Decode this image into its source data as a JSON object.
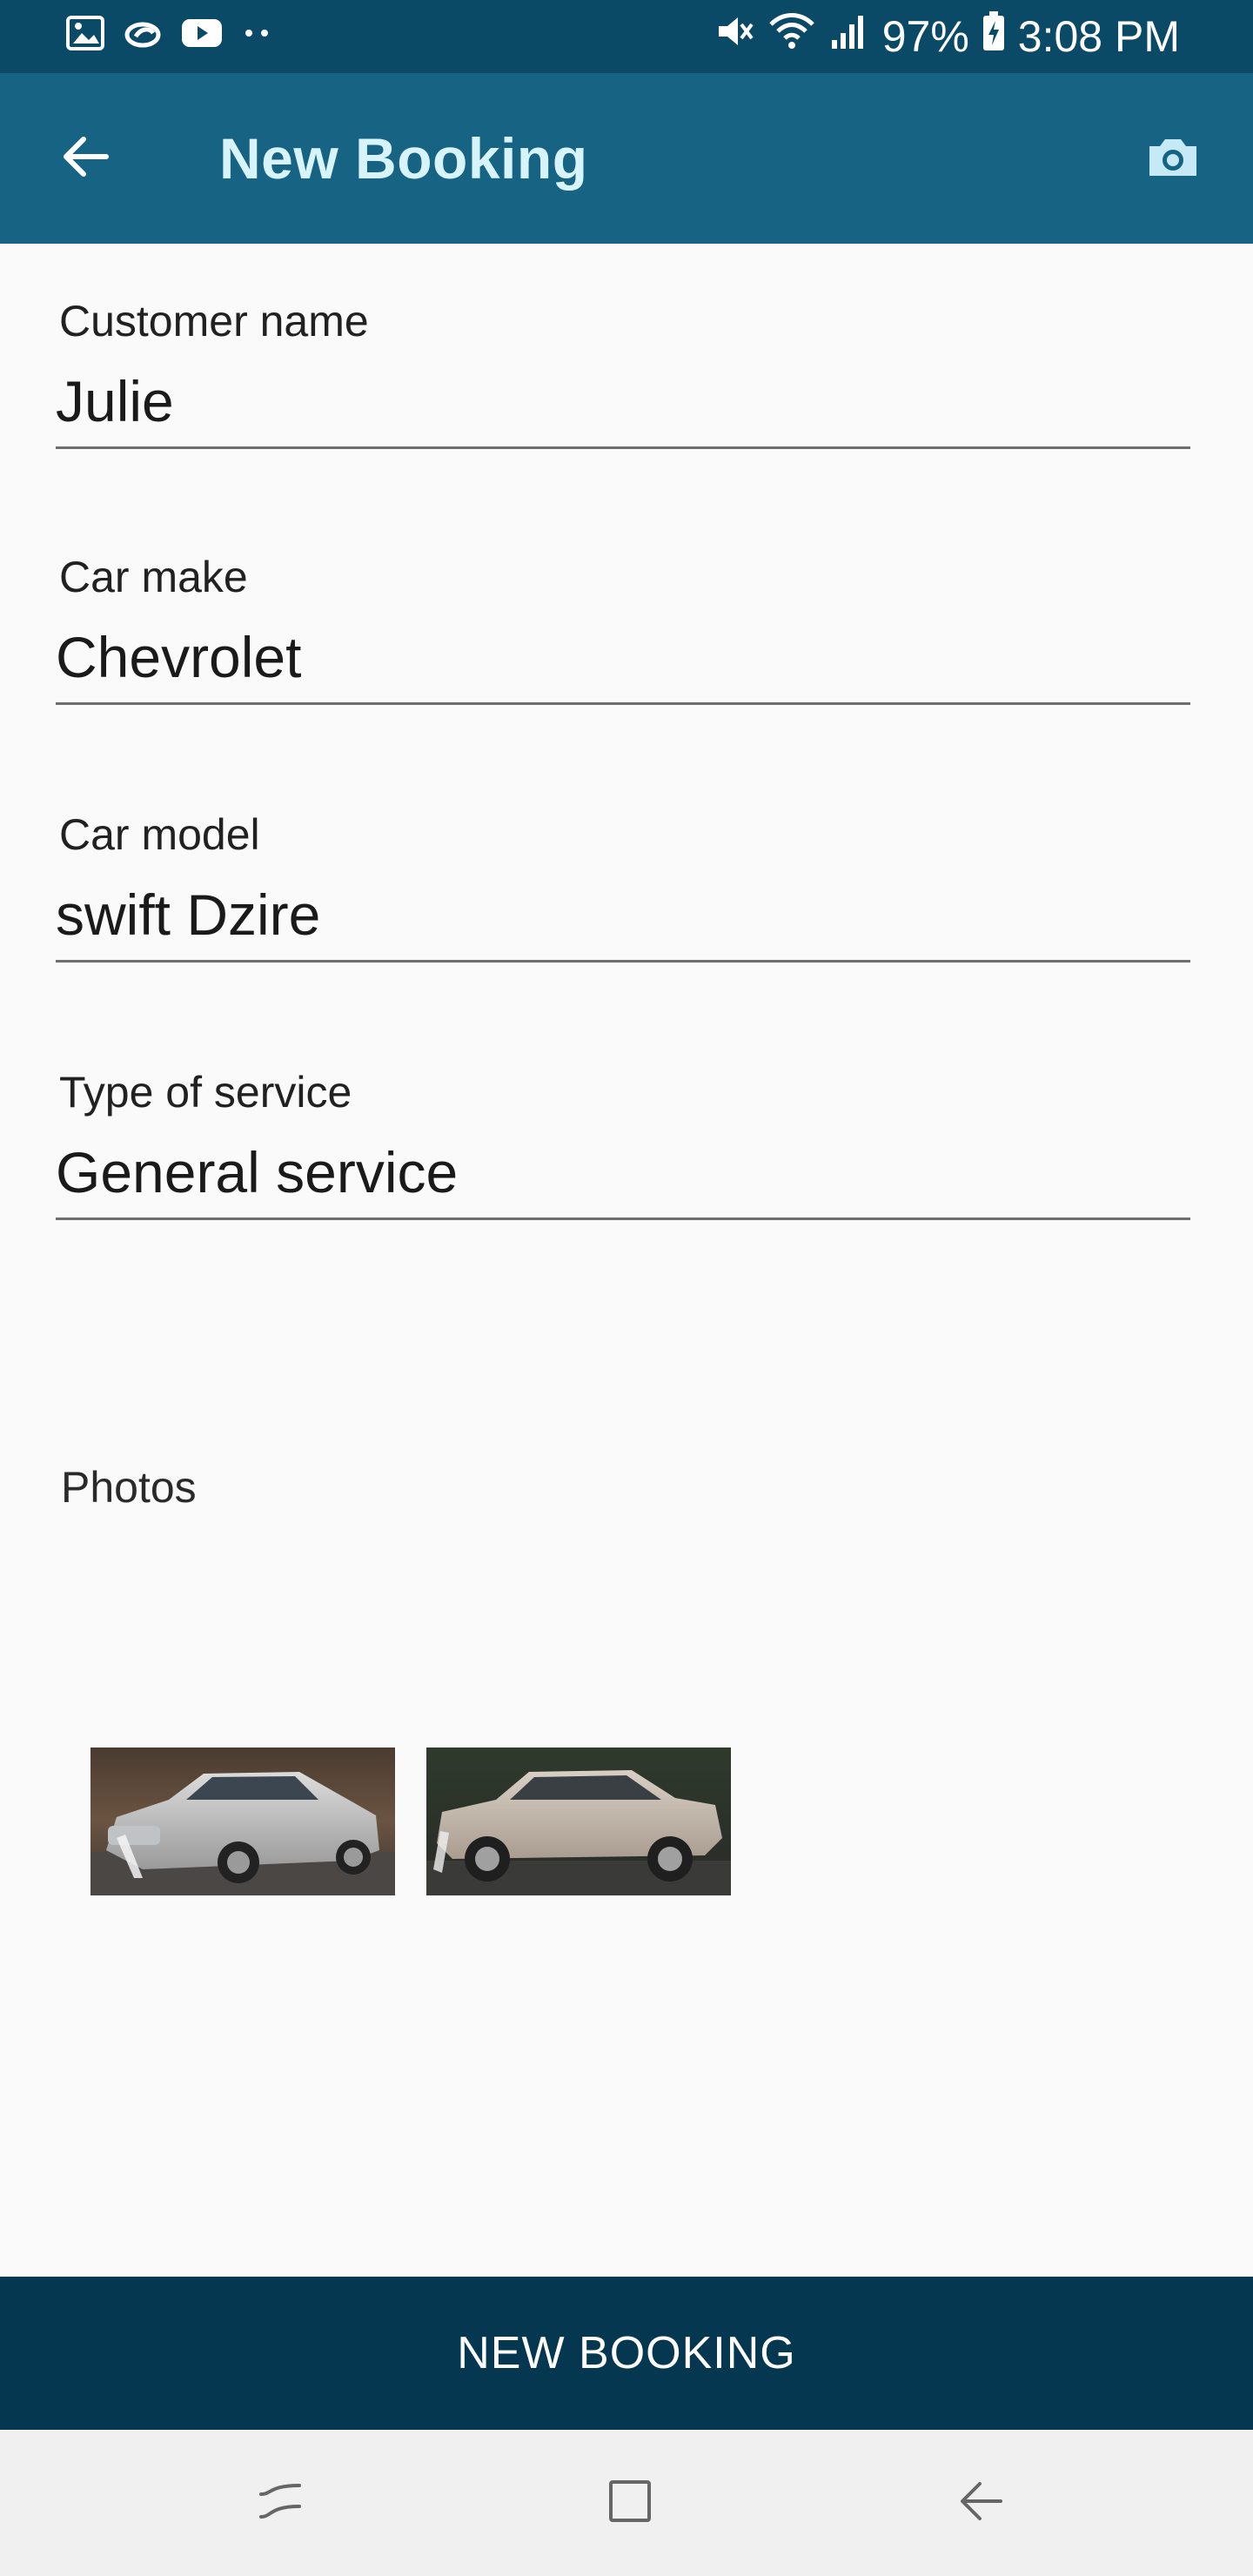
{
  "status_bar": {
    "battery": "97%",
    "time": "3:08 PM",
    "left_icons": [
      "image-icon",
      "link-icon",
      "youtube-icon",
      "more-dots-icon"
    ],
    "right_icons": [
      "mute-icon",
      "wifi-icon",
      "signal-icon",
      "battery-charging-icon"
    ]
  },
  "app_bar": {
    "title": "New Booking",
    "back_icon": "arrow-back-icon",
    "action_icon": "camera-icon"
  },
  "form": {
    "customer_name": {
      "label": "Customer name",
      "value": "Julie"
    },
    "car_make": {
      "label": "Car make",
      "value": "Chevrolet"
    },
    "car_model": {
      "label": "Car model",
      "value": "swift Dzire"
    },
    "service_type": {
      "label": "Type of service",
      "value": "General service"
    }
  },
  "photos": {
    "label": "Photos",
    "items": [
      "car-photo-front",
      "car-photo-side"
    ]
  },
  "action": {
    "label": "NEW BOOKING"
  },
  "nav_bar": {
    "icons": [
      "recents-icon",
      "home-icon",
      "back-icon"
    ]
  },
  "colors": {
    "status_bar": "#0b4a66",
    "app_bar": "#176384",
    "title_text": "#d8f4fb",
    "action_bar": "#053750",
    "background": "#fafafa"
  }
}
